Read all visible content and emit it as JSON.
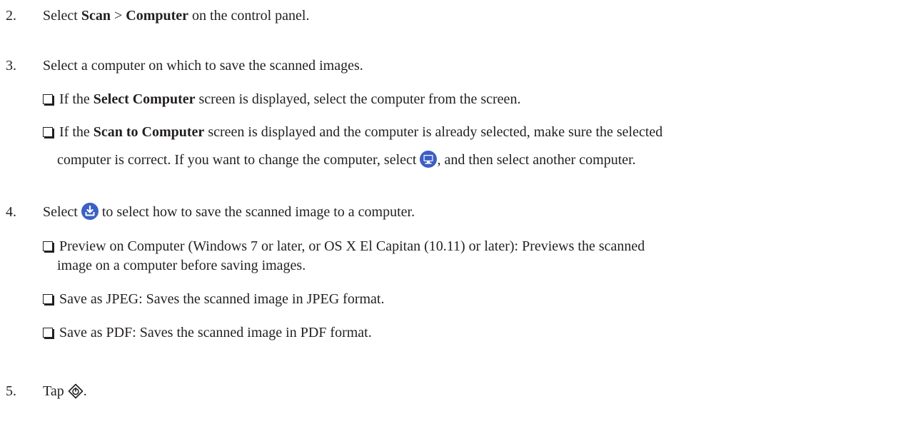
{
  "step2": {
    "number": "2.",
    "pre": "Select ",
    "bold1": "Scan",
    "sep": " > ",
    "bold2": "Computer",
    "post": " on the control panel."
  },
  "step3": {
    "number": "3.",
    "text": "Select a computer on which to save the scanned images.",
    "bullet1": {
      "pre": "If the ",
      "bold": "Select Computer",
      "post": " screen is displayed, select the computer from the screen."
    },
    "bullet2": {
      "pre": "If the ",
      "bold": "Scan to Computer",
      "post": " screen is displayed and the computer is already selected, make sure the selected",
      "cont_pre": "computer is correct. If you want to change the computer, select ",
      "cont_post": ", and then select another computer."
    }
  },
  "step4": {
    "number": "4.",
    "pre": "Select ",
    "post": " to select how to save the scanned image to a computer.",
    "bullet1": {
      "line1": "Preview on Computer (Windows 7 or later, or OS X El Capitan (10.11) or later): Previews the scanned",
      "line2": "image on a computer before saving images."
    },
    "bullet2": "Save as JPEG: Saves the scanned image in JPEG format.",
    "bullet3": "Save as PDF: Saves the scanned image in PDF format."
  },
  "step5": {
    "number": "5.",
    "pre": "Tap ",
    "post": "."
  },
  "icons": {
    "computer": "computer-icon",
    "save": "save-download-icon",
    "start": "start-diamond-icon",
    "icon_color": "#3B5FC4"
  }
}
